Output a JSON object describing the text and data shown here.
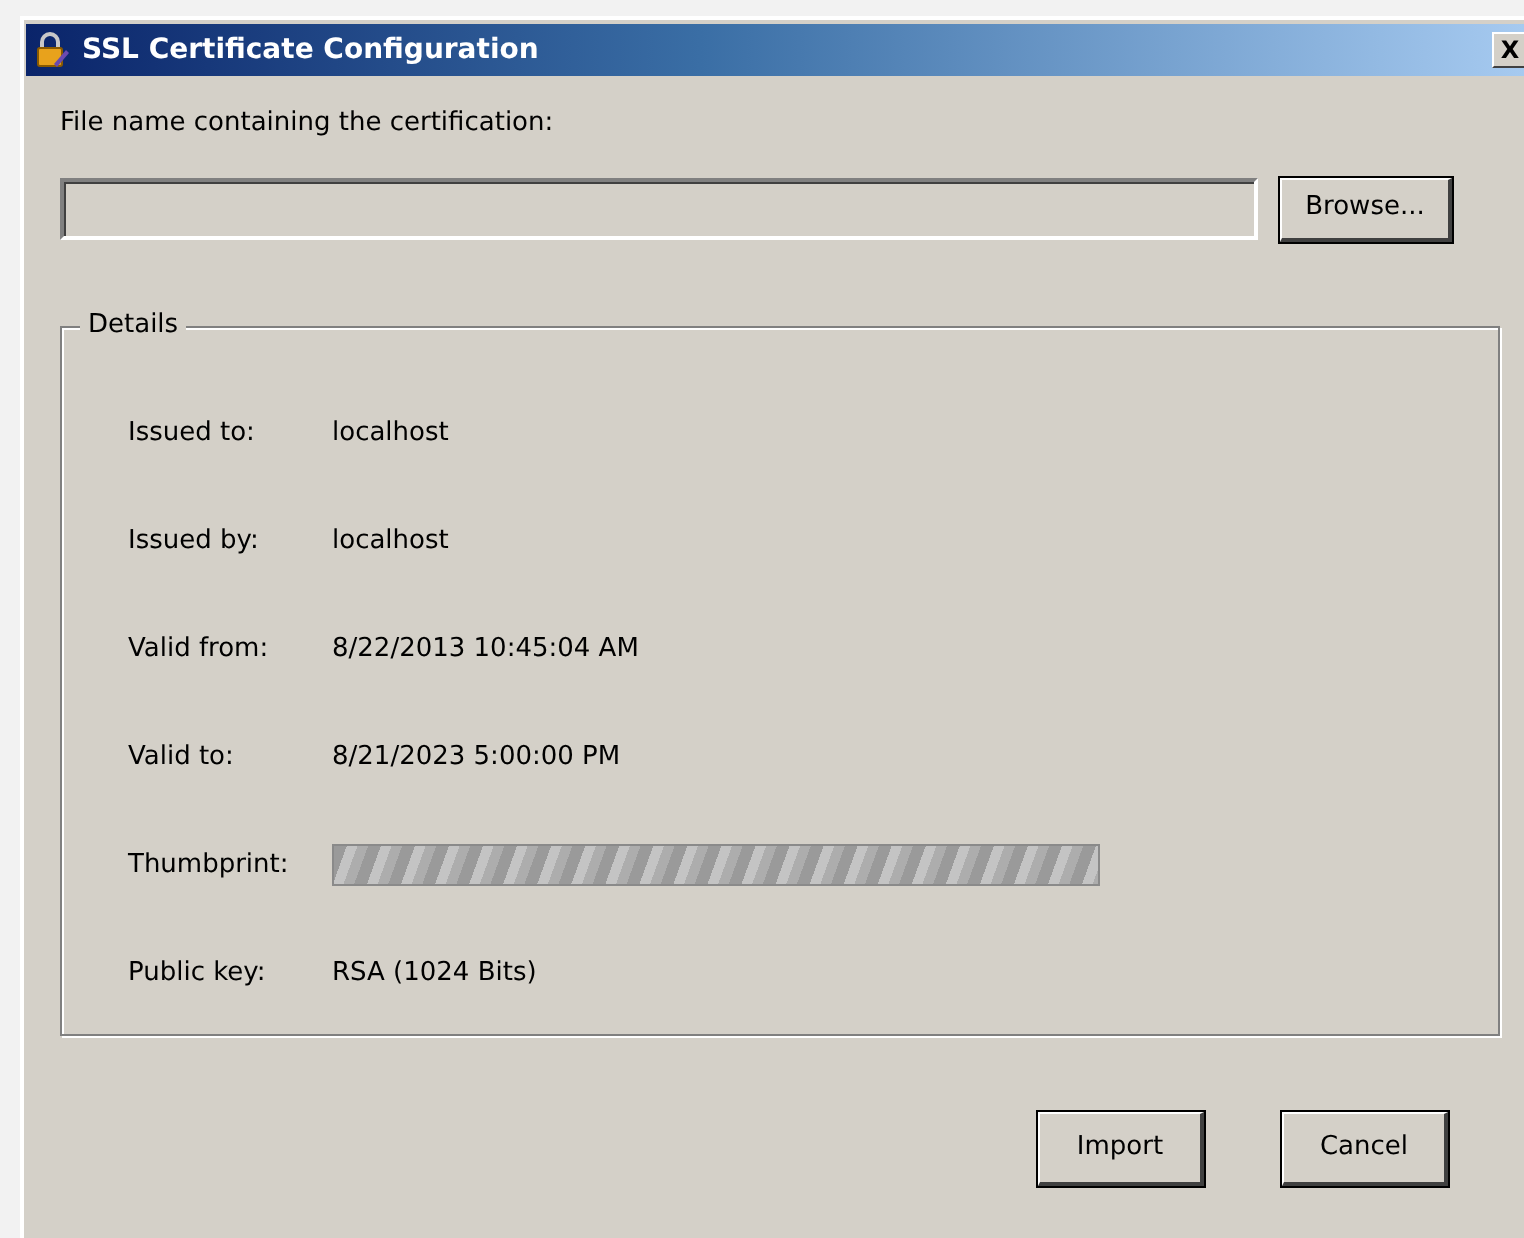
{
  "window": {
    "title": "SSL Certificate Configuration",
    "close": "X"
  },
  "file": {
    "label": "File name containing the certification:",
    "browse": "Browse..."
  },
  "details": {
    "legend": "Details",
    "rows": [
      {
        "kind": "text",
        "label": "Issued to:",
        "value": "localhost"
      },
      {
        "kind": "text",
        "label": "Issued by:",
        "value": "localhost"
      },
      {
        "kind": "text",
        "label": "Valid from:",
        "value": "8/22/2013 10:45:04 AM"
      },
      {
        "kind": "text",
        "label": "Valid to:",
        "value": "8/21/2023 5:00:00 PM"
      },
      {
        "kind": "redacted",
        "label": "Thumbprint:"
      },
      {
        "kind": "text",
        "label": "Public key:",
        "value": "RSA (1024 Bits)"
      }
    ]
  },
  "buttons": [
    "Import",
    "Cancel"
  ]
}
